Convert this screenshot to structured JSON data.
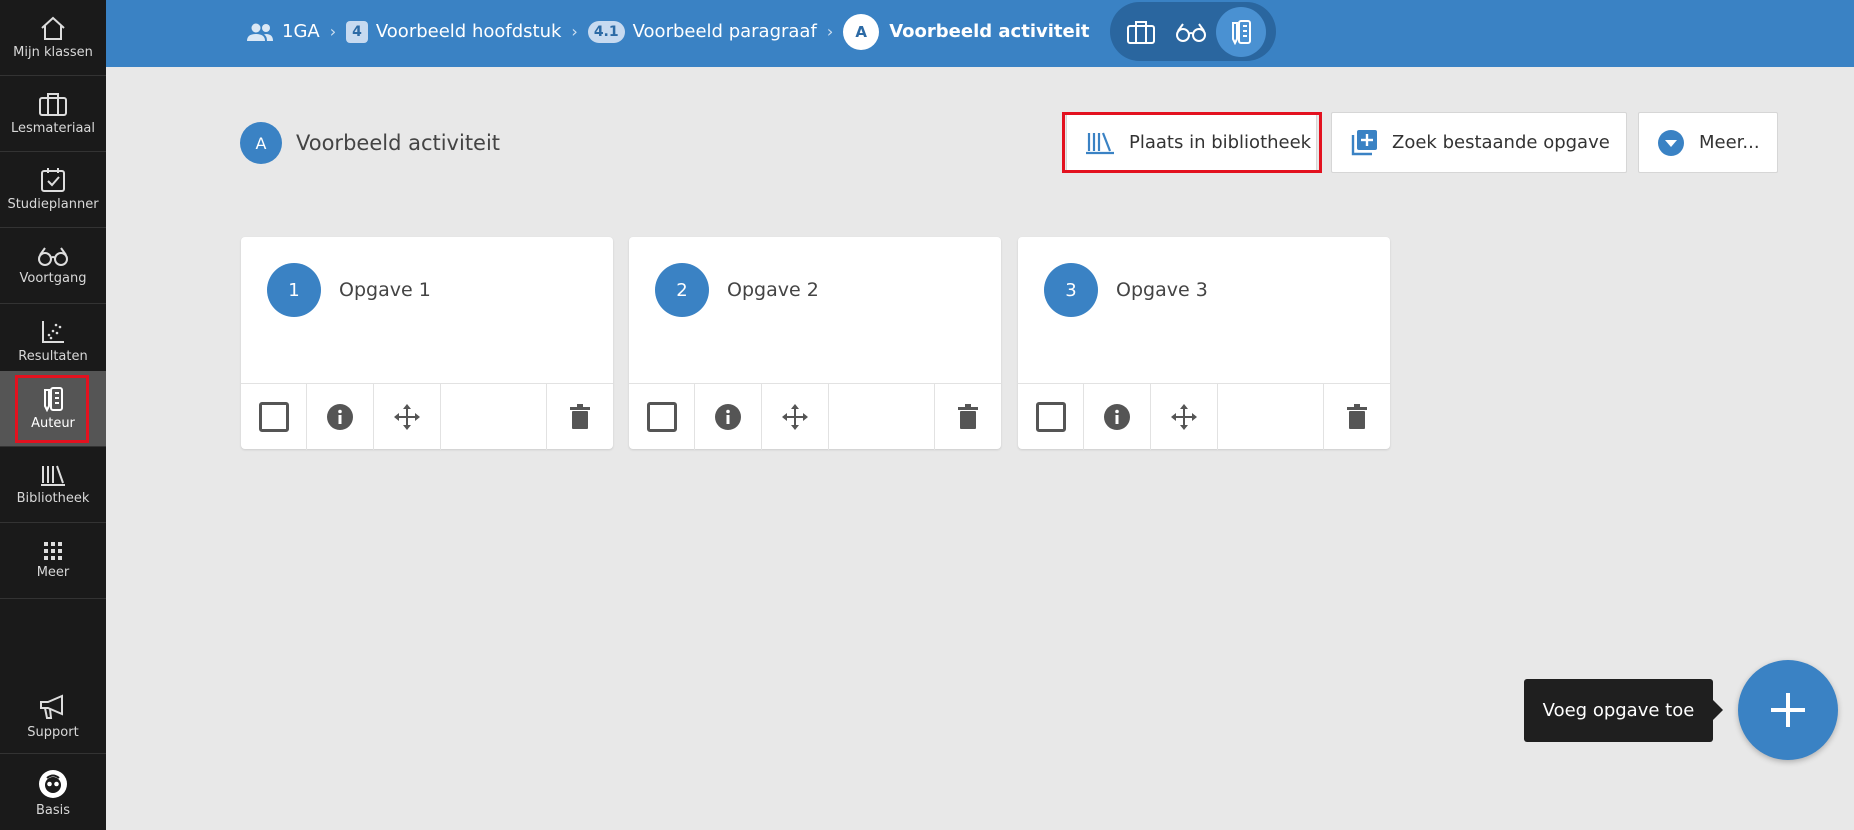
{
  "sidebar": {
    "items": [
      {
        "label": "Mijn klassen",
        "icon": "home-icon"
      },
      {
        "label": "Lesmateriaal",
        "icon": "briefcase-icon"
      },
      {
        "label": "Studieplanner",
        "icon": "calendar-check-icon"
      },
      {
        "label": "Voortgang",
        "icon": "glasses-icon"
      },
      {
        "label": "Resultaten",
        "icon": "scatter-chart-icon"
      },
      {
        "label": "Auteur",
        "icon": "author-edit-icon",
        "active": true
      },
      {
        "label": "Bibliotheek",
        "icon": "library-icon"
      },
      {
        "label": "Meer",
        "icon": "grid-icon"
      }
    ],
    "bottom": [
      {
        "label": "Support",
        "icon": "megaphone-icon"
      },
      {
        "label": "Basis",
        "icon": "avatar-icon"
      }
    ]
  },
  "breadcrumb": {
    "class_name": "1GA",
    "chapter_num": "4",
    "chapter": "Voorbeeld hoofdstuk",
    "paragraph_num": "4.1",
    "paragraph": "Voorbeeld paragraaf",
    "activity_letter": "A",
    "activity": "Voorbeeld activiteit"
  },
  "header": {
    "activity_letter": "A",
    "activity_title": "Voorbeeld activiteit",
    "btn_library": "Plaats in bibliotheek",
    "btn_search": "Zoek bestaande opgave",
    "btn_more": "Meer..."
  },
  "cards": [
    {
      "num": "1",
      "title": "Opgave 1"
    },
    {
      "num": "2",
      "title": "Opgave 2"
    },
    {
      "num": "3",
      "title": "Opgave 3"
    }
  ],
  "tooltip": "Voeg opgave toe",
  "colors": {
    "primary": "#3a82c4",
    "sidebar": "#1a1a1a",
    "highlight": "#e3111f"
  }
}
